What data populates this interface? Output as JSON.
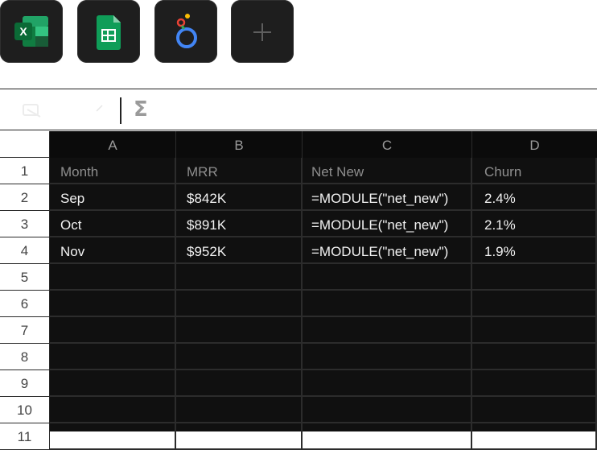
{
  "launcher": {
    "apps": [
      {
        "name": "Microsoft Excel",
        "icon": "excel-icon"
      },
      {
        "name": "Google Sheets",
        "icon": "google-sheets-icon"
      },
      {
        "name": "Looker Studio",
        "icon": "looker-icon"
      },
      {
        "name": "Add",
        "icon": "plus-icon"
      }
    ]
  },
  "formula_bar": {
    "function_symbol": "Σ"
  },
  "sheet": {
    "columns": [
      "A",
      "B",
      "C",
      "D"
    ],
    "row_numbers": [
      "1",
      "2",
      "3",
      "4",
      "5",
      "6",
      "7",
      "8",
      "9",
      "10",
      "11"
    ],
    "rows": [
      [
        "Month",
        "MRR",
        "Net New",
        "Churn"
      ],
      [
        "Sep",
        "$842K",
        "=MODULE(\"net_new\")",
        "2.4%"
      ],
      [
        "Oct",
        "$891K",
        "=MODULE(\"net_new\")",
        "2.1%"
      ],
      [
        "Nov",
        "$952K",
        "=MODULE(\"net_new\")",
        "1.9%"
      ]
    ]
  }
}
